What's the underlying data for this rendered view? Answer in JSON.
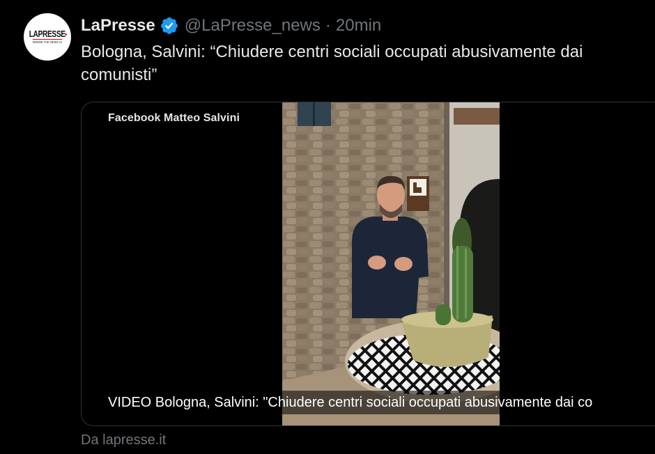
{
  "tweet": {
    "author_name": "LaPresse",
    "verified": true,
    "handle": "@LaPresse_news",
    "separator": "·",
    "time": "20min",
    "text": "Bologna, Salvini: “Chiudere centri sociali occupati abusivamente dai comunisti”"
  },
  "avatar": {
    "logo_main": "LAPRESSE",
    "logo_sub": "WHERE THE NEWS IS"
  },
  "card": {
    "overlay_label": "Facebook Matteo Salvini",
    "caption": "VIDEO Bologna, Salvini: \"Chiudere centri sociali occupati abusivamente dai co"
  },
  "source": "Da lapresse.it",
  "colors": {
    "background": "#000000",
    "text": "#e7e9ea",
    "muted": "#71767b",
    "verified_badge": "#1d9bf0",
    "border": "#2f3336"
  }
}
